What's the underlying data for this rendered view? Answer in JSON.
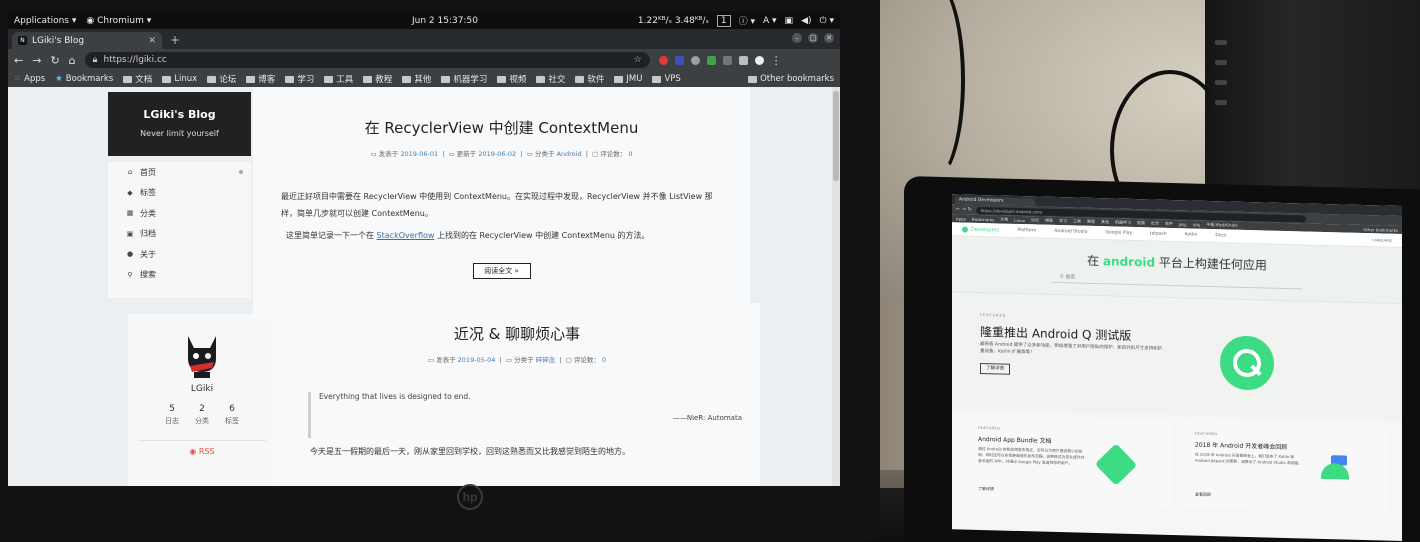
{
  "system": {
    "apps_menu": "Applications",
    "active_app": "Chromium",
    "clock": "Jun 2  15:37:50",
    "net_down": "1.22",
    "net_up": "3.48",
    "workspace": "1",
    "keyboard": "A"
  },
  "browser": {
    "tab_title": "LGiki's Blog",
    "tab_favicon_letter": "N",
    "url": "https://lgiki.cc",
    "bookmarks": [
      "Apps",
      "Bookmarks",
      "文档",
      "Linux",
      "论坛",
      "博客",
      "学习",
      "工具",
      "教程",
      "其他",
      "机器学习",
      "视频",
      "社交",
      "软件",
      "JMU",
      "VPS"
    ],
    "other_bookmarks": "Other bookmarks"
  },
  "blog": {
    "site_title": "LGiki's Blog",
    "subtitle": "Never limit yourself",
    "nav": [
      {
        "icon": "home-icon",
        "glyph": "⌂",
        "label": "首页"
      },
      {
        "icon": "tag-icon",
        "glyph": "◆",
        "label": "标签"
      },
      {
        "icon": "grid-icon",
        "glyph": "▦",
        "label": "分类"
      },
      {
        "icon": "archive-icon",
        "glyph": "▣",
        "label": "归档"
      },
      {
        "icon": "user-icon",
        "glyph": "●",
        "label": "关于"
      },
      {
        "icon": "search-icon",
        "glyph": "⚲",
        "label": "搜索"
      }
    ],
    "profile": {
      "name": "LGiki",
      "stats": [
        {
          "n": "5",
          "l": "日志"
        },
        {
          "n": "2",
          "l": "分类"
        },
        {
          "n": "6",
          "l": "标签"
        }
      ],
      "rss": "RSS"
    },
    "posts": [
      {
        "title": "在 RecyclerView 中创建 ContextMenu",
        "posted_label": "发表于",
        "posted": "2019-06-01",
        "updated_label": "更新于",
        "updated": "2019-06-02",
        "category_label": "分类于",
        "category": "Android",
        "comments_label": "评论数：",
        "comments": "0",
        "excerpt": "最近正好项目中需要在 RecyclerView 中使用到 ContextMenu。在实现过程中发现，RecyclerView 并不像 ListView 那样，简单几步就可以创建 ContextMenu。",
        "note_before": "这里简单记录一下一个在",
        "note_link": "StackOverflow",
        "note_after": "上找到的在 RecyclerView 中创建 ContextMenu 的方法。",
        "read_more": "阅读全文 »"
      },
      {
        "title": "近况 & 聊聊烦心事",
        "posted_label": "发表于",
        "posted": "2019-05-04",
        "category_label": "分类于",
        "category": "碎碎念",
        "comments_label": "评论数：",
        "comments": "0",
        "quote": "Everything that lives is designed to end.",
        "quote_source": "——NieR: Automata",
        "body": "今天是五一假期的最后一天，刚从家里回到学校，回到这熟悉而又比我感觉到陌生的地方。"
      }
    ]
  },
  "tablet": {
    "tab_title": "Android Developers",
    "url": "https://developer.android.com/",
    "bookmarks": [
      "Apps",
      "Bookmarks",
      "文档",
      "Linux",
      "论坛",
      "博客",
      "学习",
      "工具",
      "教程",
      "其他",
      "机器学习",
      "视频",
      "社交",
      "软件",
      "JMU",
      "VPS",
      "平板/iPad/Kindle"
    ],
    "other_bookmarks": "Other bookmarks",
    "brand": "Developers",
    "nav": [
      "Platform",
      "Android Studio",
      "Google Play",
      "Jetpack",
      "Kotlin",
      "Docs"
    ],
    "language": "LANGUAGE",
    "hero_prefix": "在",
    "hero_brand": "android",
    "hero_suffix": "平台上构建任何应用",
    "search_placeholder": "搜索",
    "featured_label": "FEATURED",
    "featured_title": "隆重推出 Android Q 测试版",
    "featured_desc": "最新版 Android 提供了众多新功能，例如增强了对用户隐私的保护、新的外形尺寸支持和折叠设备、Kotlin 扩展等等！",
    "featured_button": "了解详情",
    "cards": [
      {
        "label": "FEATURED",
        "title": "Android App Bundle 文档",
        "desc": "通过 Android 的新应用发布格式，您可以为用户提供更小的应用，同时还可以实现更高效的发布流程。这种格式为您生成针对各设备的 APK，并通过 Google Play 发送到您的用户。",
        "more": "了解详情"
      },
      {
        "label": "FEATURED",
        "title": "2018 年 Android 开发者峰会回顾",
        "desc": "在 2018 年 Android 开发者峰会上，我们宣布了 Kotlin 和 Android Jetpack 的更新，还推出了 Android Studio 测试版。",
        "more": "查看回顾"
      }
    ]
  },
  "monitor_brand": "hp"
}
